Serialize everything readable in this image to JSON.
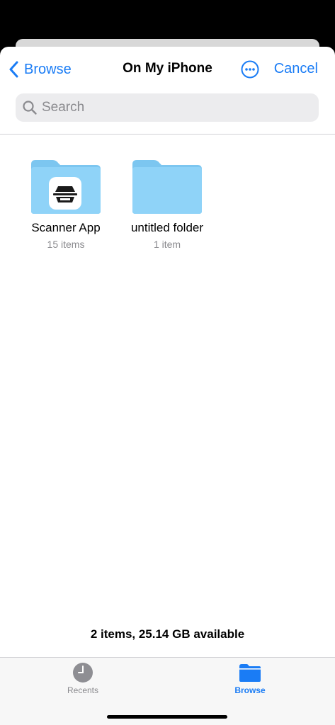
{
  "nav": {
    "back_label": "Browse",
    "title": "On My iPhone",
    "more_icon": "ellipsis-circle-icon",
    "cancel_label": "Cancel"
  },
  "search": {
    "placeholder": "Search",
    "value": ""
  },
  "folders": [
    {
      "name": "Scanner App",
      "meta": "15 items",
      "badge_icon": "scanner-icon"
    },
    {
      "name": "untitled folder",
      "meta": "1 item"
    }
  ],
  "footer": {
    "storage_text": "2 items, 25.14 GB available"
  },
  "tabbar": {
    "tabs": [
      {
        "label": "Recents",
        "icon": "clock-icon",
        "selected": false
      },
      {
        "label": "Browse",
        "icon": "folder-icon",
        "selected": true
      }
    ]
  },
  "colors": {
    "accent": "#1a7cf5",
    "folder": "#8fd3f8",
    "folder_tab": "#7cc6f0",
    "secondary_text": "#8a8a8e"
  }
}
